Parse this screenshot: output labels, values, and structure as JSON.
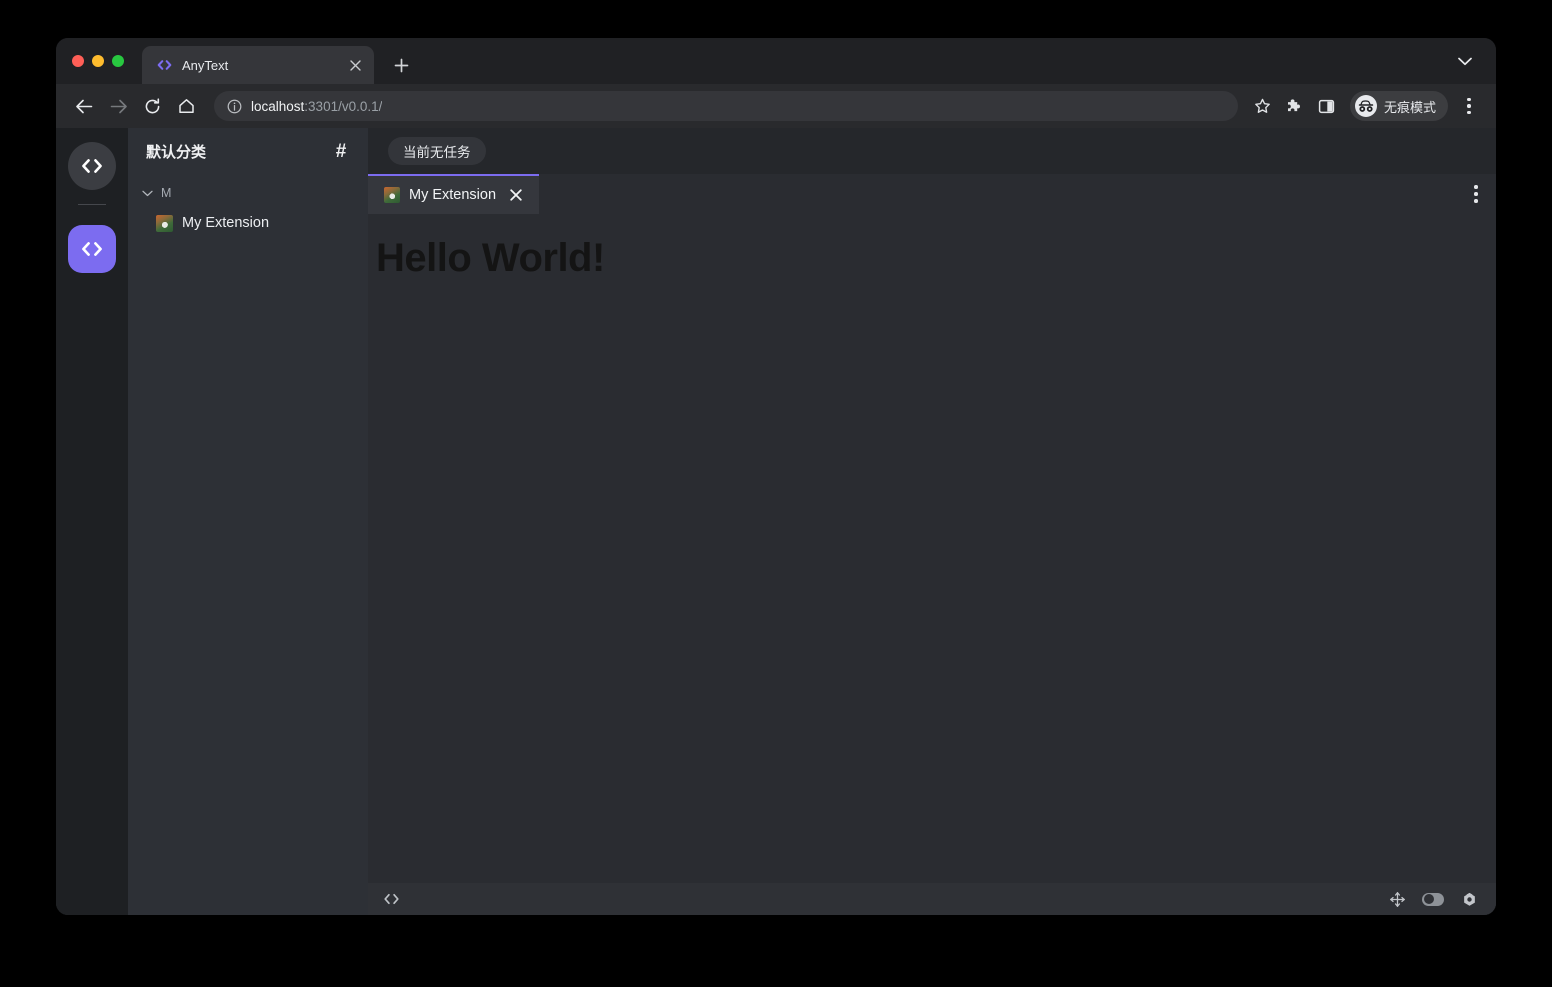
{
  "browser": {
    "tab": {
      "title": "AnyText",
      "favicon_icon": "code-brackets-icon",
      "close_icon": "close-icon"
    },
    "new_tab_label": "+",
    "window_chevron_icon": "chevron-down-icon",
    "toolbar": {
      "back_icon": "back-arrow-icon",
      "forward_icon": "forward-arrow-icon",
      "reload_icon": "reload-icon",
      "home_icon": "home-icon",
      "site_info_icon": "info-circle-icon",
      "url_host": "localhost",
      "url_rest": ":3301/v0.0.1/",
      "url_full": "localhost:3301/v0.0.1/",
      "bookmark_icon": "star-icon",
      "extensions_icon": "puzzle-piece-icon",
      "side_panel_icon": "side-panel-icon",
      "incognito_label": "无痕模式",
      "incognito_icon": "incognito-spy-icon",
      "menu_icon": "three-dots-vertical-icon"
    }
  },
  "app": {
    "activity_bar": {
      "items": [
        {
          "name": "workspace-round-icon",
          "icon": "code-brackets-icon",
          "active": false
        },
        {
          "name": "extensions-active-icon",
          "icon": "code-brackets-icon",
          "active": true
        }
      ]
    },
    "explorer": {
      "title": "默认分类",
      "hash_icon": "hash-icon",
      "tree": {
        "group_label": "M",
        "group_chevron_icon": "chevron-down-icon",
        "items": [
          {
            "label": "My Extension",
            "favicon": "extension-thumbnail-icon"
          }
        ]
      }
    },
    "main": {
      "task_badge": "当前无任务",
      "tabs": [
        {
          "label": "My Extension",
          "favicon": "extension-thumbnail-icon",
          "close_icon": "close-icon",
          "active": true
        }
      ],
      "tabbar_menu_icon": "three-dots-vertical-icon",
      "content_text": "Hello World!"
    },
    "status_bar": {
      "code_icon": "code-brackets-icon",
      "move_icon": "move-arrows-icon",
      "toggle_icon": "toggle-switch-icon",
      "settings_icon": "gear-icon"
    }
  },
  "colors": {
    "accent": "#7c6cf0",
    "window_bg": "#202124",
    "toolbar_bg": "#292a2d",
    "activity_bar_bg": "#1e2023",
    "explorer_bg": "#2d3036",
    "main_bg": "#25272b",
    "content_bg": "#2a2c31",
    "status_bg": "#2f3136"
  }
}
